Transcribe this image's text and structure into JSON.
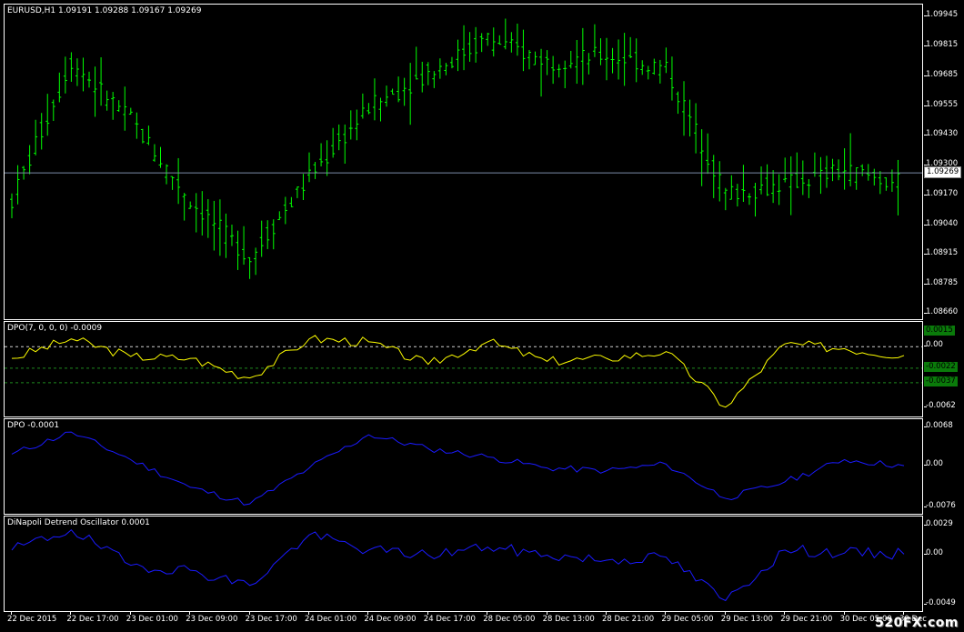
{
  "main_pane": {
    "title": "EURUSD,H1  1.09191 1.09288 1.09167 1.09269",
    "price_axis": [
      "1.09945",
      "1.09815",
      "1.09685",
      "1.09555",
      "1.09430",
      "1.09300",
      "1.09170",
      "1.09040",
      "1.08915",
      "1.08785",
      "1.08660"
    ],
    "current_price_label": "1.09269",
    "bar_color": "#00ff00",
    "current_line_color": "#7a8aa8"
  },
  "dpo1_pane": {
    "title": "DPO(7, 0, 0, 0) -0.0009",
    "axis": [
      "0.0015",
      "0.00",
      "-0.0022",
      "-0.0037",
      "-0.0062"
    ],
    "highlight_labels": [
      "0.0015",
      "-0.0022",
      "-0.0037"
    ],
    "line_color": "#ffff00"
  },
  "dpo2_pane": {
    "title": "DPO -0.0001",
    "axis": [
      "0.0068",
      "0.00",
      "-0.0076"
    ],
    "line_color": "#1a1aff"
  },
  "dinapoli_pane": {
    "title": "DiNapoli Detrend Oscillator 0.0001",
    "axis": [
      "0.0029",
      "0.00",
      "-0.0049"
    ],
    "line_color": "#1a1aff"
  },
  "time_axis": [
    "22 Dec 2015",
    "22 Dec 17:00",
    "23 Dec 01:00",
    "23 Dec 09:00",
    "23 Dec 17:00",
    "24 Dec 01:00",
    "24 Dec 09:00",
    "24 Dec 17:00",
    "28 Dec 05:00",
    "28 Dec 13:00",
    "28 Dec 21:00",
    "29 Dec 05:00",
    "29 Dec 13:00",
    "29 Dec 21:00",
    "30 Dec 05:00",
    "30 Dec"
  ],
  "watermark": "520FX.com",
  "chart_data": [
    {
      "type": "ohlc",
      "symbol": "EURUSD,H1",
      "ylim": [
        1.0866,
        1.0995
      ],
      "x": [
        "22 Dec 2015",
        "22 Dec 17:00",
        "23 Dec 01:00",
        "23 Dec 09:00",
        "23 Dec 17:00",
        "24 Dec 01:00",
        "24 Dec 09:00",
        "24 Dec 17:00",
        "28 Dec 05:00",
        "28 Dec 13:00",
        "28 Dec 21:00",
        "29 Dec 05:00",
        "29 Dec 13:00",
        "29 Dec 21:00",
        "30 Dec 05:00",
        "30 Dec"
      ],
      "close": [
        1.0915,
        1.0975,
        1.095,
        1.0915,
        1.089,
        1.0925,
        1.0955,
        1.097,
        1.0985,
        1.0975,
        1.0978,
        1.0972,
        1.0918,
        1.0922,
        1.0928,
        1.0922
      ],
      "last": 1.09269
    },
    {
      "type": "line",
      "name": "DPO(7, 0, 0, 0)",
      "ylim": [
        -0.0066,
        0.0018
      ],
      "levels": [
        0.0,
        -0.0022,
        -0.0037
      ],
      "values": [
        -0.0012,
        0.0008,
        -0.001,
        -0.0012,
        -0.0032,
        0.0008,
        0.0005,
        -0.0018,
        0.0005,
        -0.0015,
        -0.0012,
        -0.0005,
        -0.0062,
        0.0003,
        -0.0002,
        -0.0009
      ]
    },
    {
      "type": "line",
      "name": "DPO",
      "ylim": [
        -0.0078,
        0.007
      ],
      "values": [
        0.002,
        0.006,
        0.001,
        -0.004,
        -0.007,
        -0.0005,
        0.0055,
        0.003,
        0.0015,
        -0.0005,
        -0.001,
        0.0002,
        -0.006,
        -0.003,
        0.001,
        -0.0001
      ]
    },
    {
      "type": "line",
      "name": "DiNapoli Detrend Oscillator",
      "ylim": [
        -0.005,
        0.0031
      ],
      "values": [
        0.0005,
        0.0025,
        -0.001,
        -0.0015,
        -0.003,
        0.002,
        0.0005,
        0.0,
        0.0008,
        0.0,
        -0.0005,
        -0.0002,
        -0.0045,
        0.0005,
        0.0002,
        0.0001
      ]
    }
  ]
}
